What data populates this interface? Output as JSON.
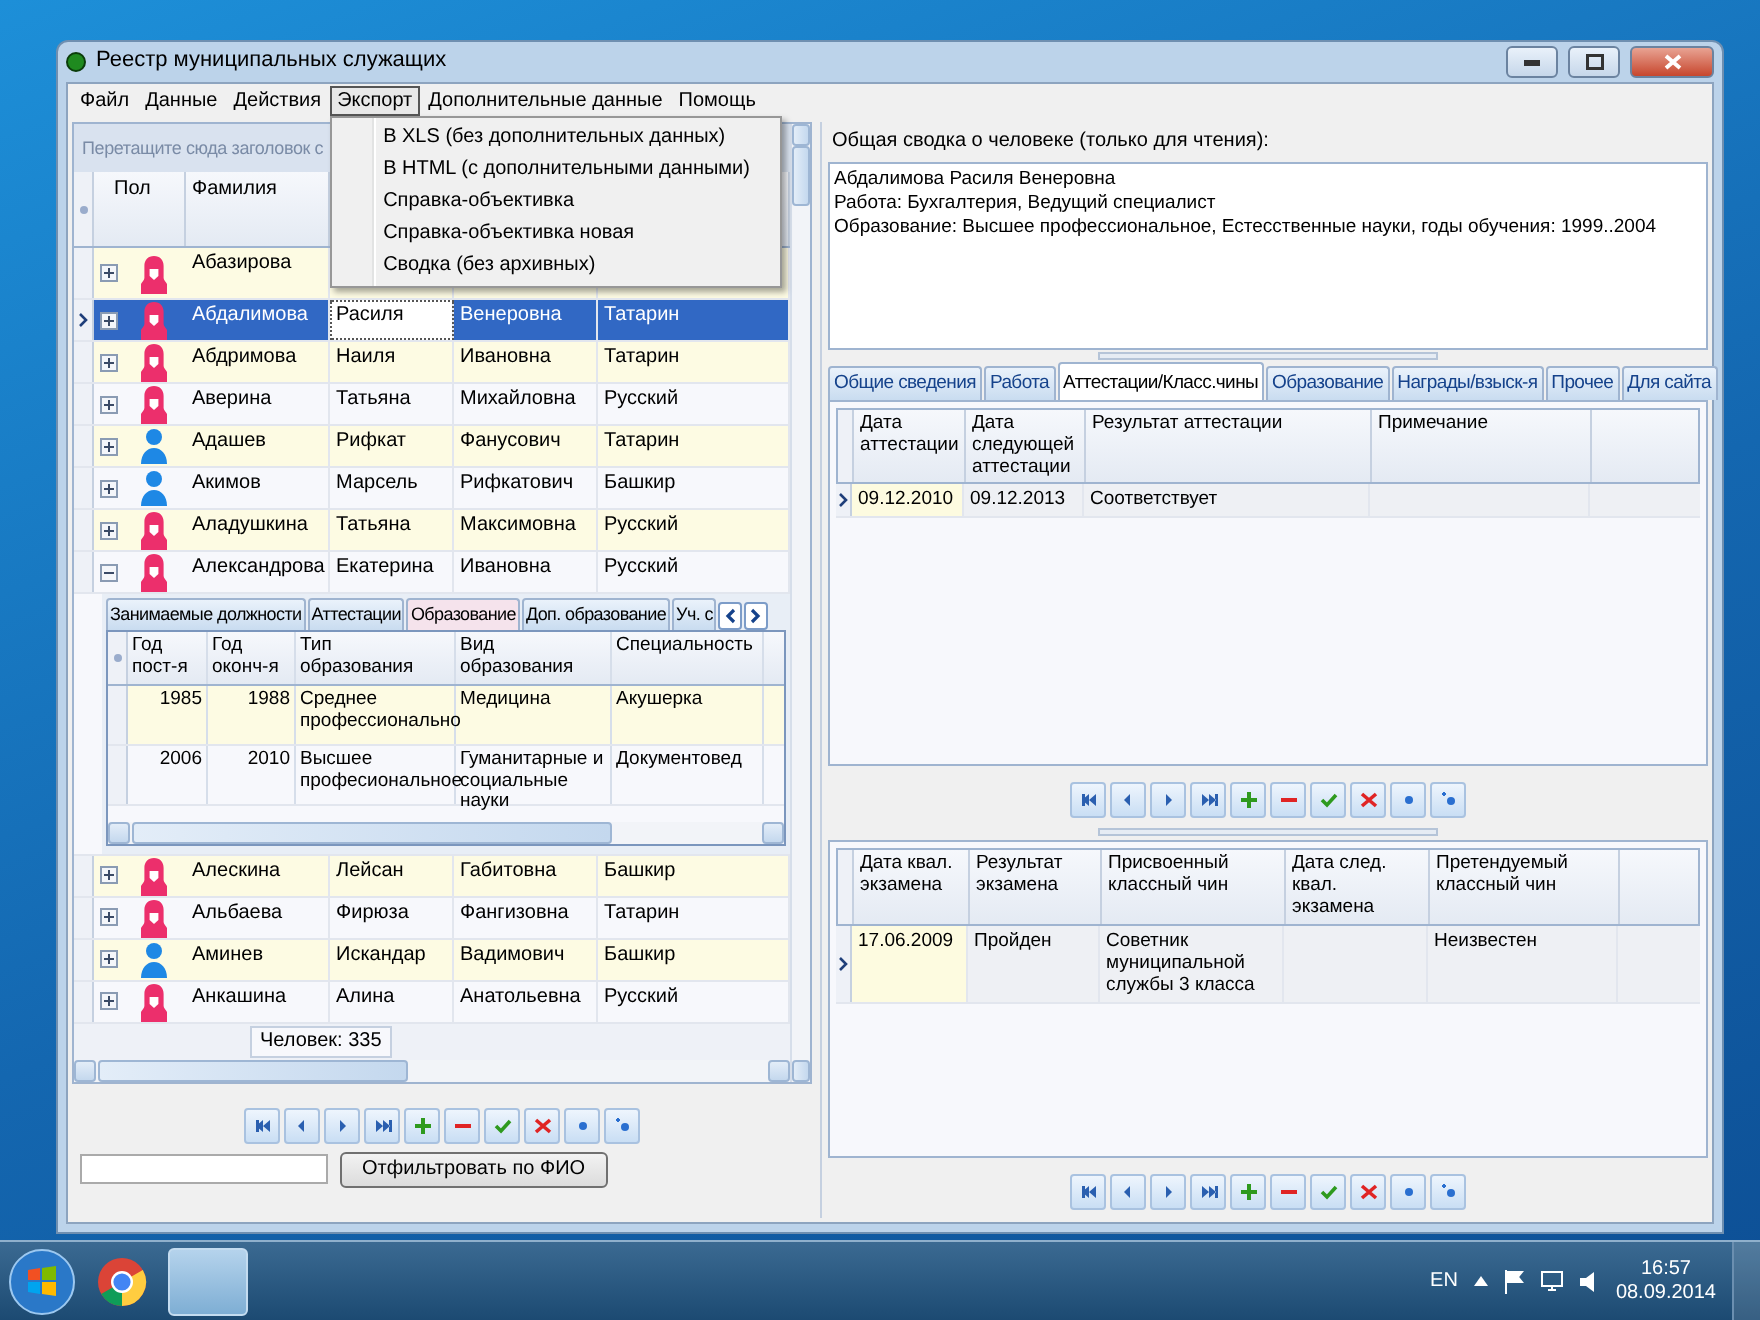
{
  "window": {
    "title": "Реестр муниципальных служащих"
  },
  "menu": [
    {
      "label": "Файл",
      "open": false
    },
    {
      "label": "Данные",
      "open": false
    },
    {
      "label": "Действия",
      "open": false
    },
    {
      "label": "Экспорт",
      "open": true,
      "items": [
        "В XLS (без дополнительных данных)",
        "В HTML (с дополнительными данными)",
        "Справка-объективка",
        "Справка-объективка новая",
        "Сводка (без архивных)"
      ]
    },
    {
      "label": "Дополнительные данные",
      "open": false
    },
    {
      "label": "Помощь",
      "open": false
    }
  ],
  "people": {
    "group_hint": "Перетащите сюда заголовок с",
    "kind_column": "Пол",
    "columns": [
      "Фамилия"
    ],
    "rows": [
      {
        "kind": "female",
        "cells": [
          "Абазирова"
        ],
        "selected": false,
        "expanded": false
      },
      {
        "kind": "female",
        "cells": [
          "Абдалимова",
          "Расиля",
          "Венеровна",
          "Татарин"
        ],
        "selected": true,
        "expanded": false
      },
      {
        "kind": "female",
        "cells": [
          "Абдримова",
          "Наиля",
          "Ивановна",
          "Татарин"
        ],
        "selected": false,
        "expanded": false
      },
      {
        "kind": "female",
        "cells": [
          "Аверина",
          "Татьяна",
          "Михайловна",
          "Русский"
        ],
        "selected": false,
        "expanded": false
      },
      {
        "kind": "male",
        "cells": [
          "Адашев",
          "Рифкат",
          "Фанусович",
          "Татарин"
        ],
        "selected": false,
        "expanded": false
      },
      {
        "kind": "male",
        "cells": [
          "Акимов",
          "Марсель",
          "Рифкатович",
          "Башкир"
        ],
        "selected": false,
        "expanded": false
      },
      {
        "kind": "female",
        "cells": [
          "Аладушкина",
          "Татьяна",
          "Максимовна",
          "Русский"
        ],
        "selected": false,
        "expanded": false
      },
      {
        "kind": "female",
        "cells": [
          "Александрова",
          "Екатерина",
          "Ивановна",
          "Русский"
        ],
        "selected": false,
        "expanded": true,
        "detail": {
          "tabs": [
            {
              "label": "Занимаемые должности",
              "selected": false
            },
            {
              "label": "Аттестации",
              "selected": false
            },
            {
              "label": "Образование",
              "selected": true
            },
            {
              "label": "Доп. образование",
              "selected": false
            },
            {
              "label": "Уч. с",
              "selected": false
            }
          ],
          "columns": [
            "Год пост-я",
            "Год оконч-я",
            "Тип образования",
            "Вид образования",
            "Специальность"
          ],
          "rows": [
            [
              "1985",
              "1988",
              "Среднее профессионально",
              "Медицина",
              "Акушерка"
            ],
            [
              "2006",
              "2010",
              "Высшее професиональное",
              "Гуманитарные и социальные науки",
              "Документовед"
            ]
          ]
        }
      },
      {
        "kind": "female",
        "cells": [
          "Алескина",
          "Лейсан",
          "Габитовна",
          "Башкир"
        ],
        "selected": false,
        "expanded": false
      },
      {
        "kind": "female",
        "cells": [
          "Альбаева",
          "Фирюза",
          "Фангизовна",
          "Татарин"
        ],
        "selected": false,
        "expanded": false
      },
      {
        "kind": "male",
        "cells": [
          "Аминев",
          "Искандар",
          "Вадимович",
          "Башкир"
        ],
        "selected": false,
        "expanded": false
      },
      {
        "kind": "female",
        "cells": [
          "Анкашина",
          "Алина",
          "Анатольевна",
          "Русский"
        ],
        "selected": false,
        "expanded": false
      }
    ],
    "count": "Человек: 335",
    "filter_button": "Отфильтровать по ФИО"
  },
  "summary": {
    "label": "Общая сводка о человеке (только для чтения):",
    "lines": [
      "Абдалимова Расиля Венеровна",
      "Работа: Бухгалтерия, Ведущий специалист",
      "Образование: Высшее профессиональное, Естесственные науки, годы обучения: 1999..2004"
    ]
  },
  "tabs": [
    {
      "label": "Общие сведения",
      "selected": false
    },
    {
      "label": "Работа",
      "selected": false
    },
    {
      "label": "Аттестации/Класс.чины",
      "selected": true
    },
    {
      "label": "Образование",
      "selected": false
    },
    {
      "label": "Награды/взыск-я",
      "selected": false
    },
    {
      "label": "Прочее",
      "selected": false
    },
    {
      "label": "Для сайта",
      "selected": false
    }
  ],
  "attestations": {
    "columns": [
      "Дата аттестации",
      "Дата следующей аттестации",
      "Результат аттестации",
      "Примечание"
    ],
    "rows": [
      {
        "cells": [
          "09.12.2010",
          "09.12.2013",
          "Соответствует",
          null
        ],
        "selected": true
      }
    ]
  },
  "exams": {
    "columns": [
      "Дата квал. экзамена",
      "Результат экзамена",
      "Присвоенный классный чин",
      "Дата след. квал. экзамена",
      "Претендуемый классный чин"
    ],
    "rows": [
      {
        "cells": [
          "17.06.2009",
          "Пройден",
          "Советник муниципальной службы 3 класса",
          null,
          "Неизвестен"
        ],
        "selected": true
      }
    ]
  },
  "taskbar": {
    "language": "EN",
    "time": "16:57",
    "date": "08.09.2014"
  }
}
